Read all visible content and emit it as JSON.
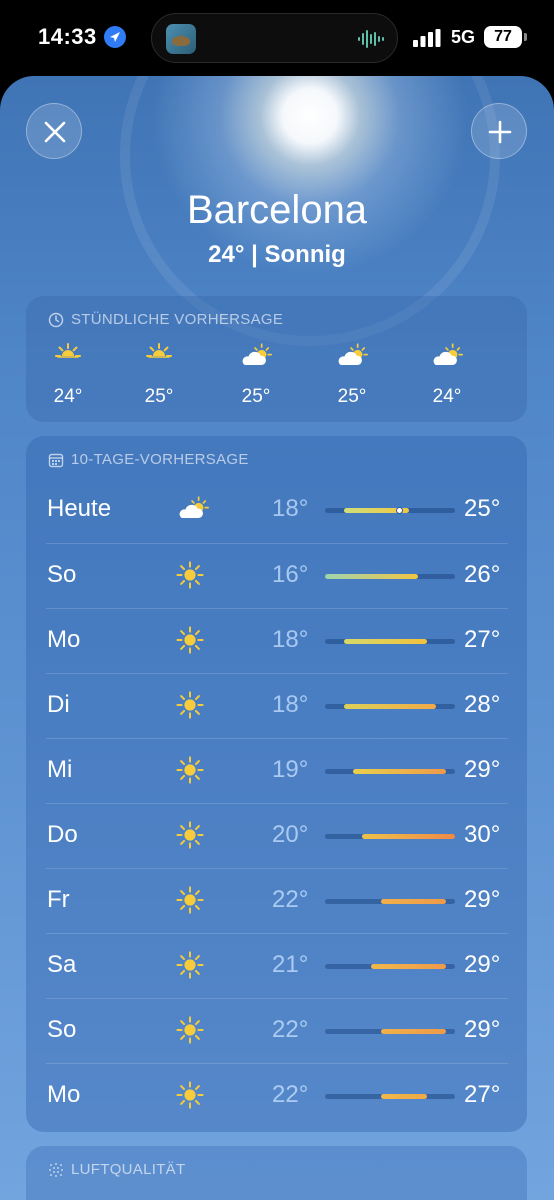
{
  "status": {
    "time": "14:33",
    "network": "5G",
    "battery": "77",
    "icons": [
      "location-arrow-icon",
      "cellular-signal-icon",
      "audio-wave-icon"
    ]
  },
  "header": {
    "city": "Barcelona",
    "summary": "24° | Sonnig",
    "close_icon": "close-icon",
    "add_icon": "plus-icon"
  },
  "hourly": {
    "title": "STÜNDLICHE VORHERSAGE",
    "items": [
      {
        "icon": "sun-icon",
        "temp": "24°"
      },
      {
        "icon": "sun-icon",
        "temp": "25°"
      },
      {
        "icon": "partly-cloudy-icon",
        "temp": "25°"
      },
      {
        "icon": "partly-cloudy-icon",
        "temp": "25°"
      },
      {
        "icon": "partly-cloudy-icon",
        "temp": "24°"
      }
    ]
  },
  "forecast": {
    "title": "10-TAGE-VORHERSAGE",
    "range": [
      16,
      30
    ],
    "current": 24,
    "days": [
      {
        "day": "Heute",
        "icon": "partly-cloudy-icon",
        "low": "18°",
        "high": "25°",
        "lo": 18,
        "hi": 25,
        "color_from": "#cfe07a",
        "color_to": "#f2c542"
      },
      {
        "day": "So",
        "icon": "sun-icon",
        "low": "16°",
        "high": "26°",
        "lo": 16,
        "hi": 26,
        "color_from": "#9fd4b0",
        "color_to": "#f2c542"
      },
      {
        "day": "Mo",
        "icon": "sun-icon",
        "low": "18°",
        "high": "27°",
        "lo": 18,
        "hi": 27,
        "color_from": "#d6d96a",
        "color_to": "#f2c13c"
      },
      {
        "day": "Di",
        "icon": "sun-icon",
        "low": "18°",
        "high": "28°",
        "lo": 18,
        "hi": 28,
        "color_from": "#dcd25a",
        "color_to": "#f0a948"
      },
      {
        "day": "Mi",
        "icon": "sun-icon",
        "low": "19°",
        "high": "29°",
        "lo": 19,
        "hi": 29,
        "color_from": "#ead04c",
        "color_to": "#ef9a4a"
      },
      {
        "day": "Do",
        "icon": "sun-icon",
        "low": "20°",
        "high": "30°",
        "lo": 20,
        "hi": 30,
        "color_from": "#efc24a",
        "color_to": "#ee8a48"
      },
      {
        "day": "Fr",
        "icon": "sun-icon",
        "low": "22°",
        "high": "29°",
        "lo": 22,
        "hi": 29,
        "color_from": "#f0b04a",
        "color_to": "#ef9a4a"
      },
      {
        "day": "Sa",
        "icon": "sun-icon",
        "low": "21°",
        "high": "29°",
        "lo": 21,
        "hi": 29,
        "color_from": "#f0b84a",
        "color_to": "#ef9a4a"
      },
      {
        "day": "So",
        "icon": "sun-icon",
        "low": "22°",
        "high": "29°",
        "lo": 22,
        "hi": 29,
        "color_from": "#f0b04a",
        "color_to": "#ef9a4a"
      },
      {
        "day": "Mo",
        "icon": "sun-icon",
        "low": "22°",
        "high": "27°",
        "lo": 22,
        "hi": 27,
        "color_from": "#f0b84a",
        "color_to": "#f1a946"
      }
    ]
  },
  "air_quality": {
    "title": "LUFTQUALITÄT"
  }
}
